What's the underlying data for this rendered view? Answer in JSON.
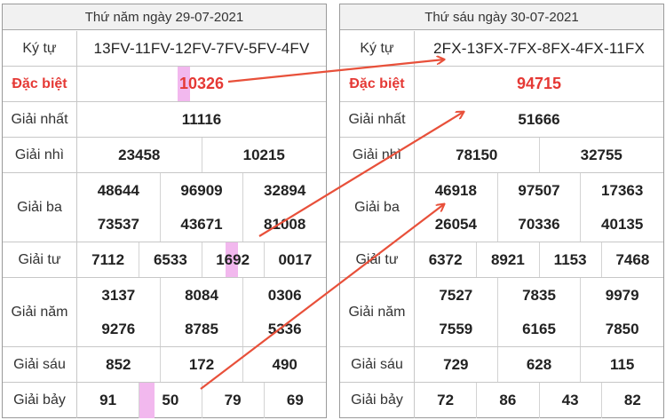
{
  "left": {
    "date": "Thứ năm ngày 29-07-2021",
    "rows": [
      {
        "key": "ky_tu",
        "label": "Ký tự",
        "lines": [
          [
            "13FV-11FV-12FV-7FV-5FV-4FV"
          ]
        ]
      },
      {
        "key": "dac_biet",
        "label": "Đặc biệt",
        "lines": [
          [
            "10326"
          ]
        ]
      },
      {
        "key": "giai_nhat",
        "label": "Giải nhất",
        "lines": [
          [
            "11116"
          ]
        ]
      },
      {
        "key": "giai_nhi",
        "label": "Giải nhì",
        "lines": [
          [
            "23458",
            "10215"
          ]
        ]
      },
      {
        "key": "giai_ba",
        "label": "Giải ba",
        "lines": [
          [
            "48644",
            "96909",
            "32894"
          ],
          [
            "73537",
            "43671",
            "81008"
          ]
        ]
      },
      {
        "key": "giai_tu",
        "label": "Giải tư",
        "lines": [
          [
            "7112",
            "6533",
            "1692",
            "0017"
          ]
        ]
      },
      {
        "key": "giai_nam",
        "label": "Giải năm",
        "lines": [
          [
            "3137",
            "8084",
            "0306"
          ],
          [
            "9276",
            "8785",
            "5336"
          ]
        ]
      },
      {
        "key": "giai_sau",
        "label": "Giải sáu",
        "lines": [
          [
            "852",
            "172",
            "490"
          ]
        ]
      },
      {
        "key": "giai_bay",
        "label": "Giải bảy",
        "lines": [
          [
            "91",
            "50",
            "79",
            "69"
          ]
        ]
      }
    ]
  },
  "right": {
    "date": "Thứ sáu ngày 30-07-2021",
    "rows": [
      {
        "key": "ky_tu",
        "label": "Ký tự",
        "lines": [
          [
            "2FX-13FX-7FX-8FX-4FX-11FX"
          ]
        ]
      },
      {
        "key": "dac_biet",
        "label": "Đặc biệt",
        "lines": [
          [
            "94715"
          ]
        ]
      },
      {
        "key": "giai_nhat",
        "label": "Giải nhất",
        "lines": [
          [
            "51666"
          ]
        ]
      },
      {
        "key": "giai_nhi",
        "label": "Giải nhì",
        "lines": [
          [
            "78150",
            "32755"
          ]
        ]
      },
      {
        "key": "giai_ba",
        "label": "Giải ba",
        "lines": [
          [
            "46918",
            "97507",
            "17363"
          ],
          [
            "26054",
            "70336",
            "40135"
          ]
        ]
      },
      {
        "key": "giai_tu",
        "label": "Giải tư",
        "lines": [
          [
            "6372",
            "8921",
            "1153",
            "7468"
          ]
        ]
      },
      {
        "key": "giai_nam",
        "label": "Giải năm",
        "lines": [
          [
            "7527",
            "7835",
            "9979"
          ],
          [
            "7559",
            "6165",
            "7850"
          ]
        ]
      },
      {
        "key": "giai_sau",
        "label": "Giải sáu",
        "lines": [
          [
            "729",
            "628",
            "115"
          ]
        ]
      },
      {
        "key": "giai_bay",
        "label": "Giải bảy",
        "lines": [
          [
            "72",
            "86",
            "43",
            "82"
          ]
        ]
      }
    ]
  },
  "highlight_color": "#f2b8ee",
  "prize_red": "#e53935",
  "arrow_color": "#e8503a"
}
